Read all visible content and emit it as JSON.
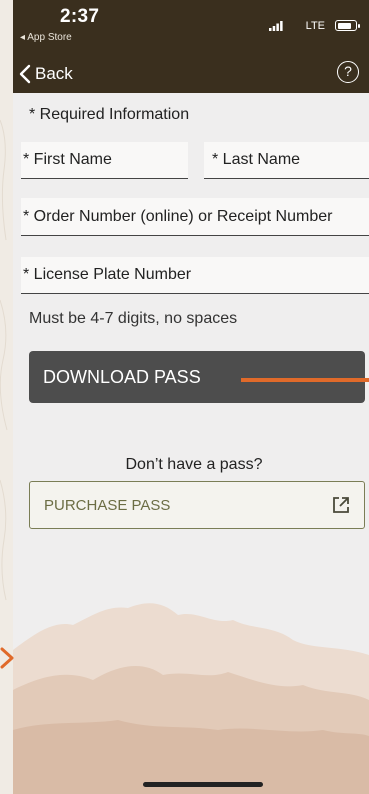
{
  "status": {
    "time": "2:37",
    "back_app": "◂ App Store",
    "network": "LTE"
  },
  "nav": {
    "back_label": "Back",
    "help_label": "?"
  },
  "form": {
    "required_label": "* Required Information",
    "first_name_placeholder": "* First Name",
    "last_name_placeholder": "* Last Name",
    "order_placeholder": "* Order Number (online) or Receipt Number",
    "plate_placeholder": "* License Plate Number",
    "plate_hint": "Must be 4-7 digits, no spaces"
  },
  "actions": {
    "download_label": "DOWNLOAD PASS",
    "no_pass_label": "Don’t have a pass?",
    "purchase_label": "PURCHASE PASS"
  },
  "colors": {
    "header_bg": "#3a2f1e",
    "download_bg": "#4d4d4d",
    "purchase_border": "#7a7d55",
    "annotation_arrow": "#e06a2a"
  }
}
